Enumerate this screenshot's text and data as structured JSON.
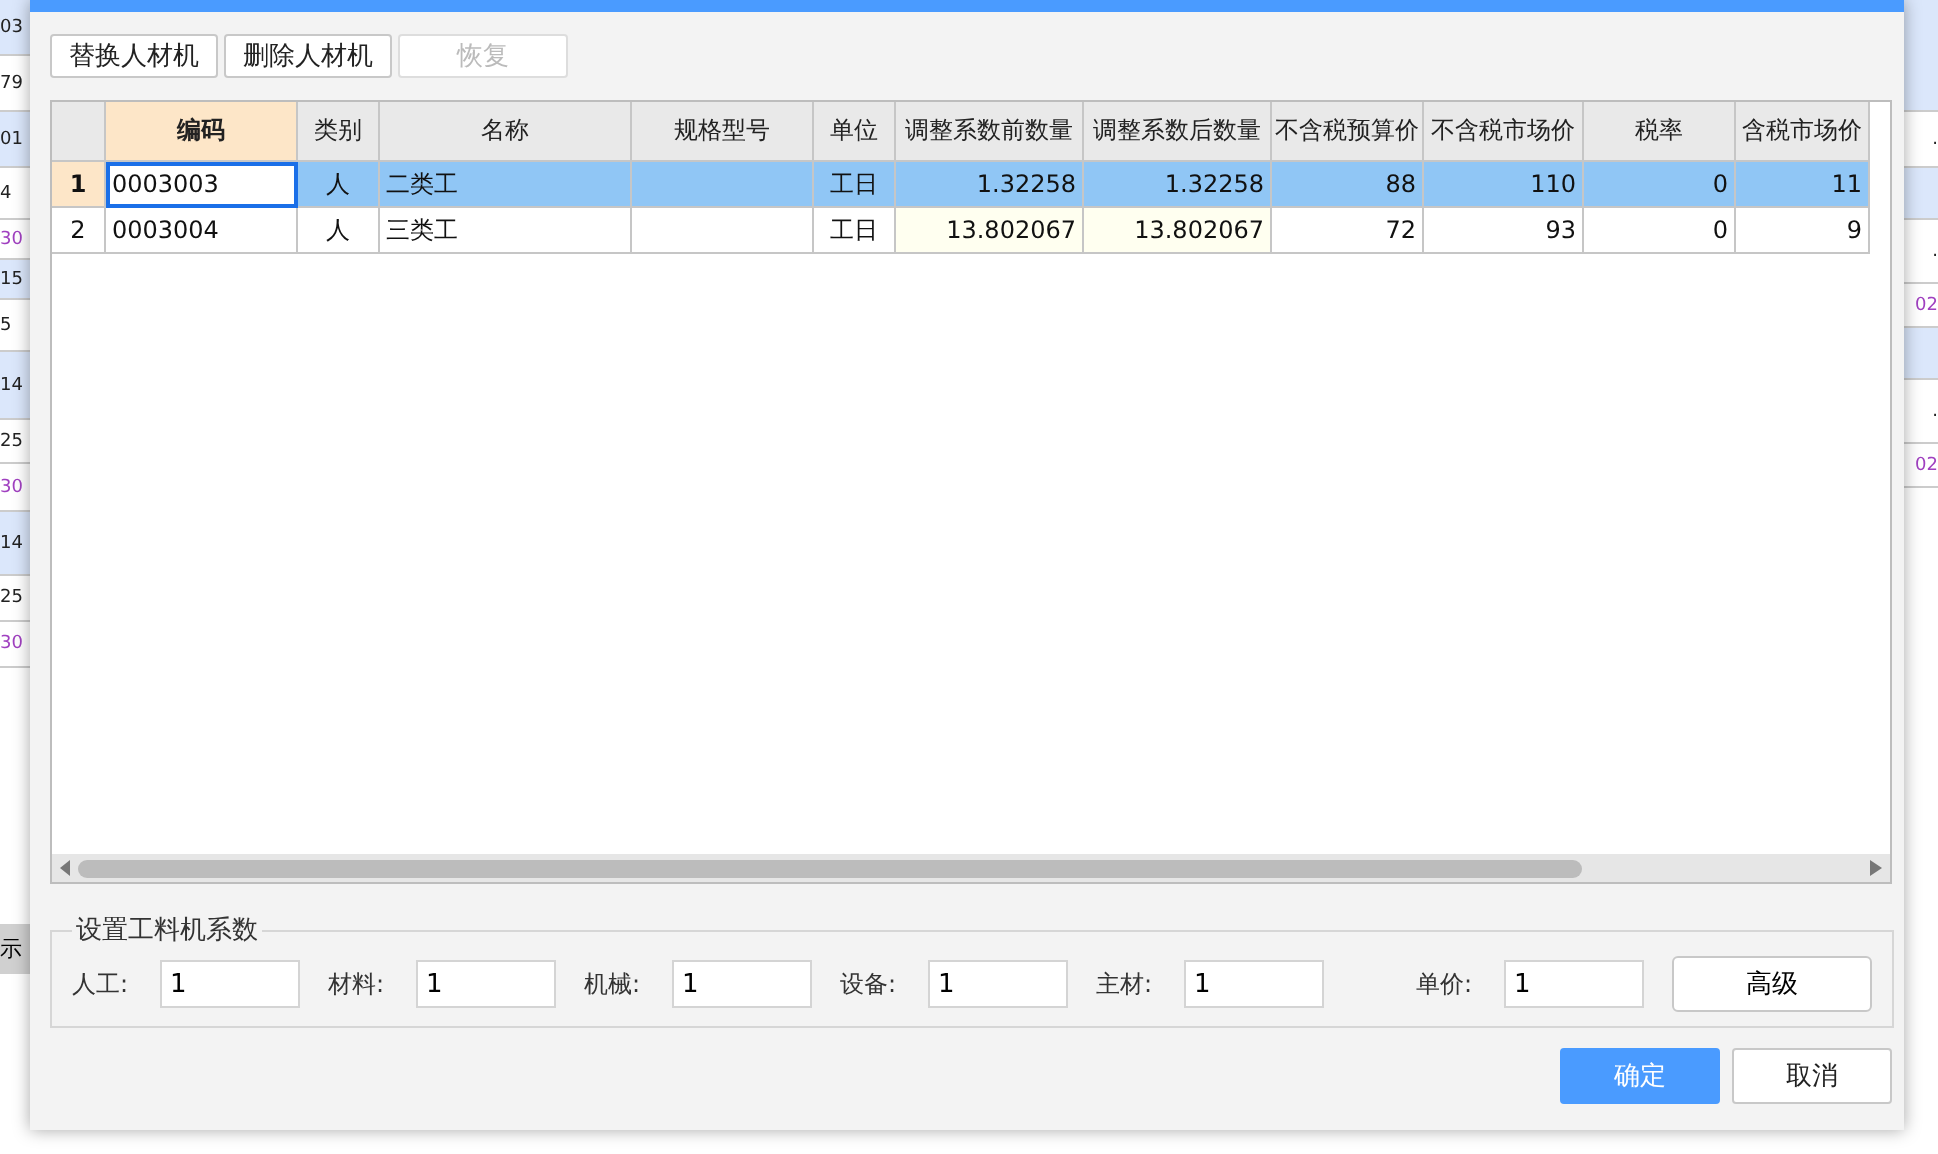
{
  "background": {
    "left_column": [
      {
        "text": "03",
        "shaded": true,
        "link": false
      },
      {
        "text": "79",
        "shaded": false,
        "link": false
      },
      {
        "text": "01",
        "shaded": true,
        "link": false
      },
      {
        "text": "4",
        "shaded": false,
        "link": false
      },
      {
        "text": "30",
        "shaded": false,
        "link": true
      },
      {
        "text": "15",
        "shaded": true,
        "link": false
      },
      {
        "text": "5",
        "shaded": false,
        "link": false
      },
      {
        "text": "14",
        "shaded": true,
        "link": false
      },
      {
        "text": "25",
        "shaded": false,
        "link": false
      },
      {
        "text": "30",
        "shaded": false,
        "link": true
      },
      {
        "text": "14",
        "shaded": true,
        "link": false
      },
      {
        "text": "25",
        "shaded": false,
        "link": false
      },
      {
        "text": "30",
        "shaded": false,
        "link": true
      }
    ],
    "right_column": [
      {
        "shaded": true,
        "link": false
      },
      {
        "text": ".",
        "shaded": false,
        "link": false
      },
      {
        "shaded": true,
        "link": false
      },
      {
        "text": ".",
        "shaded": false,
        "link": false
      },
      {
        "text": "02",
        "shaded": false,
        "link": true
      },
      {
        "shaded": true,
        "link": false
      },
      {
        "text": ".",
        "shaded": false,
        "link": false
      },
      {
        "text": "02",
        "shaded": false,
        "link": true
      }
    ],
    "tab_fragment": "示"
  },
  "dialog": {
    "toolbar": [
      {
        "label": "替换人材机",
        "disabled": false
      },
      {
        "label": "删除人材机",
        "disabled": false
      },
      {
        "label": "恢复",
        "disabled": true
      }
    ],
    "table": {
      "columns": [
        {
          "active": false,
          "editable": false
        },
        {
          "label": "编码",
          "active": true,
          "editable": false
        },
        {
          "label": "类别",
          "active": false,
          "editable": false
        },
        {
          "label": "名称",
          "active": false,
          "editable": false
        },
        {
          "label": "规格型号",
          "active": false,
          "editable": false
        },
        {
          "label": "单位",
          "active": false,
          "editable": false
        },
        {
          "label": "调整系数前数量",
          "active": false,
          "editable": true
        },
        {
          "label": "调整系数后数量",
          "active": false,
          "editable": true
        },
        {
          "label": "不含税预算价",
          "active": false,
          "editable": false
        },
        {
          "label": "不含税市场价",
          "active": false,
          "editable": false
        },
        {
          "label": "税率",
          "active": false,
          "editable": false
        },
        {
          "label": "含税市场价",
          "active": false,
          "editable": false
        }
      ],
      "rows": [
        {
          "selected": true,
          "cells": [
            "1",
            "0003003",
            "人",
            "二类工",
            "",
            "工日",
            "1.32258",
            "1.32258",
            "88",
            "110",
            "0",
            "11"
          ]
        },
        {
          "selected": false,
          "cells": [
            "2",
            "0003004",
            "人",
            "三类工",
            "",
            "工日",
            "13.802067",
            "13.802067",
            "72",
            "93",
            "0",
            "9"
          ]
        }
      ]
    },
    "coefficients": {
      "title": "设置工料机系数",
      "fields": [
        {
          "label": "人工:",
          "value": "1"
        },
        {
          "label": "材料:",
          "value": "1"
        },
        {
          "label": "机械:",
          "value": "1"
        },
        {
          "label": "设备:",
          "value": "1"
        },
        {
          "label": "主材:",
          "value": "1"
        },
        {
          "label": "单价:",
          "value": "1"
        }
      ],
      "advanced_button": "高级"
    },
    "buttons": [
      {
        "label": "确定",
        "primary": true
      },
      {
        "label": "取消",
        "primary": false
      }
    ]
  }
}
